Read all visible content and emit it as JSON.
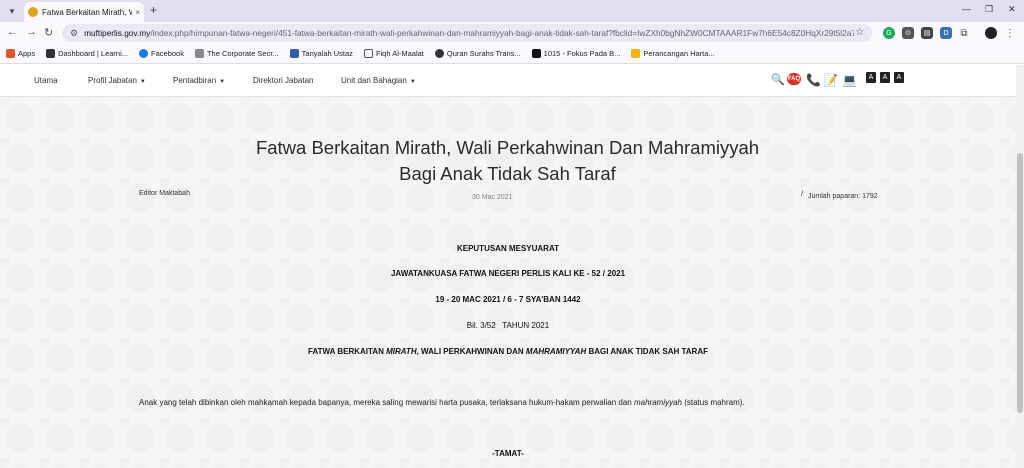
{
  "browser": {
    "tab_title": "Fatwa Berkaitan Mirath, Wali P...",
    "tab_close": "×",
    "new_tab": "+",
    "url_host": "muftiperlis.gov.my",
    "url_path": "/index.php/himpunan-fatwa-negeri/451-fatwa-berkaitan-mirath-wali-perkahwinan-dan-mahramiyyah-bagi-anak-tidak-sah-taraf?fbclid=IwZXh0bgNhZW0CMTAAAR1Fw7h6E54c8Z0HqXr29t5l2a7m43MD3kauk-w1n..."
  },
  "bookmarks": [
    {
      "label": "Apps",
      "color": "#e0562b"
    },
    {
      "label": "Dashboard | Learni...",
      "color": "#333333"
    },
    {
      "label": "Facebook",
      "color": "#1877f2"
    },
    {
      "label": "The Corporate Secr...",
      "color": "#888888"
    },
    {
      "label": "Tanyalah Ustaz",
      "color": "#2f5ea8"
    },
    {
      "label": "Fiqh Al-Maalat",
      "color": "#555555"
    },
    {
      "label": "Quran Surahs Trans...",
      "color": "#333333"
    },
    {
      "label": "1015 - Fokus Pada B...",
      "color": "#111111"
    },
    {
      "label": "Perancangan Harta...",
      "color": "#f2b400"
    }
  ],
  "sitenav": {
    "items": [
      {
        "label": "Utama",
        "has_chevron": false
      },
      {
        "label": "Profil Jabatan",
        "has_chevron": true
      },
      {
        "label": "Pentadbiran",
        "has_chevron": true
      },
      {
        "label": "Direktori Jabatan",
        "has_chevron": false
      },
      {
        "label": "Unit dan Bahagian",
        "has_chevron": true
      }
    ],
    "size_buttons": [
      "A",
      "A",
      "A"
    ]
  },
  "article": {
    "title_line1": "Fatwa Berkaitan Mirath, Wali Perkahwinan Dan Mahramiyyah",
    "title_line2": "Bagi Anak Tidak Sah Taraf",
    "author": "Editor Maktabah",
    "date": "30 Mac 2021",
    "views": "Jumlah paparan: 1792",
    "heading1": "KEPUTUSAN MESYUARAT",
    "heading2": "JAWATANKUASA FATWA NEGERI PERLIS KALI KE - 52 / 2021",
    "heading3": "19 - 20 MAC 2021 / 6 - 7 SYA'BAN 1442",
    "ref": "Bil. 3/52   TAHUN 2021",
    "fatwa_title_a": "FATWA BERKAITAN ",
    "fatwa_title_b": "MIRATH",
    "fatwa_title_c": ", WALI PERKAHWINAN DAN ",
    "fatwa_title_d": "MAHRAMIYYAH",
    "fatwa_title_e": " BAGI ANAK TIDAK SAH TARAF",
    "body_a": "Anak yang telah dibinkan oleh mahkamah kepada bapanya, mereka saling mewarisi harta pusaka, terlaksana hukum-hakam perwalian dan ",
    "body_b": "mahramiyyah",
    "body_c": " (status mahram).",
    "end": "-TAMAT-"
  }
}
